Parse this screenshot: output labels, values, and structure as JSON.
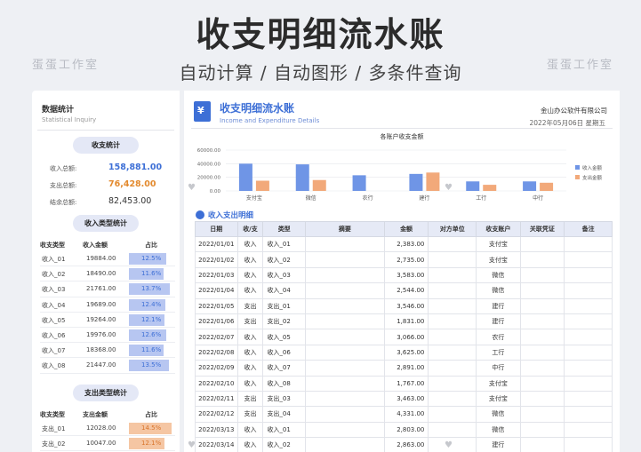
{
  "header": {
    "title": "收支明细流水账",
    "subtitle": "自动计算 / 自动图形 / 多条件查询",
    "watermark": "蛋蛋工作室"
  },
  "left": {
    "title": "数据统计",
    "subtitle": "Statistical Inquiry",
    "summary_pill": "收支统计",
    "summary": [
      {
        "label": "收入总额:",
        "value": "158,881.00",
        "color": "#3d6fd6"
      },
      {
        "label": "支出总额:",
        "value": "76,428.00",
        "color": "#e38a2e"
      },
      {
        "label": "结余总额:",
        "value": "82,453.00",
        "color": "#333333"
      }
    ],
    "income_pill": "收入类型统计",
    "income_head": [
      "收支类型",
      "收入金额",
      "占比"
    ],
    "income_rows": [
      {
        "type": "收入_01",
        "amount": "19884.00",
        "pct": "12.5%",
        "frac": 0.125
      },
      {
        "type": "收入_02",
        "amount": "18490.00",
        "pct": "11.6%",
        "frac": 0.116
      },
      {
        "type": "收入_03",
        "amount": "21761.00",
        "pct": "13.7%",
        "frac": 0.137
      },
      {
        "type": "收入_04",
        "amount": "19689.00",
        "pct": "12.4%",
        "frac": 0.124
      },
      {
        "type": "收入_05",
        "amount": "19264.00",
        "pct": "12.1%",
        "frac": 0.121
      },
      {
        "type": "收入_06",
        "amount": "19976.00",
        "pct": "12.6%",
        "frac": 0.126
      },
      {
        "type": "收入_07",
        "amount": "18368.00",
        "pct": "11.6%",
        "frac": 0.116
      },
      {
        "type": "收入_08",
        "amount": "21447.00",
        "pct": "13.5%",
        "frac": 0.135
      }
    ],
    "expense_pill": "支出类型统计",
    "expense_head": [
      "收支类型",
      "支出金额",
      "占比"
    ],
    "expense_rows": [
      {
        "type": "支出_01",
        "amount": "12028.00",
        "pct": "14.5%",
        "frac": 0.145
      },
      {
        "type": "支出_02",
        "amount": "10047.00",
        "pct": "12.1%",
        "frac": 0.121
      }
    ],
    "income_bar_color": "#b7c6f1",
    "expense_bar_color": "#f5c6a3"
  },
  "right": {
    "title": "收支明细流水账",
    "subtitle": "Income and Expenditure Details",
    "company": "金山办公软件有限公司",
    "date": "2022年05月06日   星期五",
    "icon": "wallet-icon",
    "section_title": "收入支出明细",
    "columns": [
      "日期",
      "收/支",
      "类型",
      "摘要",
      "金额",
      "对方单位",
      "收支账户",
      "关联凭证",
      "备注"
    ],
    "rows": [
      [
        "2022/01/01",
        "收入",
        "收入_01",
        "",
        "2,383.00",
        "",
        "支付宝",
        "",
        ""
      ],
      [
        "2022/01/02",
        "收入",
        "收入_02",
        "",
        "2,735.00",
        "",
        "支付宝",
        "",
        ""
      ],
      [
        "2022/01/03",
        "收入",
        "收入_03",
        "",
        "3,583.00",
        "",
        "微信",
        "",
        ""
      ],
      [
        "2022/01/04",
        "收入",
        "收入_04",
        "",
        "2,544.00",
        "",
        "微信",
        "",
        ""
      ],
      [
        "2022/01/05",
        "支出",
        "支出_01",
        "",
        "3,546.00",
        "",
        "建行",
        "",
        ""
      ],
      [
        "2022/01/06",
        "支出",
        "支出_02",
        "",
        "1,831.00",
        "",
        "建行",
        "",
        ""
      ],
      [
        "2022/02/07",
        "收入",
        "收入_05",
        "",
        "3,066.00",
        "",
        "农行",
        "",
        ""
      ],
      [
        "2022/02/08",
        "收入",
        "收入_06",
        "",
        "3,625.00",
        "",
        "工行",
        "",
        ""
      ],
      [
        "2022/02/09",
        "收入",
        "收入_07",
        "",
        "2,891.00",
        "",
        "中行",
        "",
        ""
      ],
      [
        "2022/02/10",
        "收入",
        "收入_08",
        "",
        "1,767.00",
        "",
        "支付宝",
        "",
        ""
      ],
      [
        "2022/02/11",
        "支出",
        "支出_03",
        "",
        "3,463.00",
        "",
        "支付宝",
        "",
        ""
      ],
      [
        "2022/02/12",
        "支出",
        "支出_04",
        "",
        "4,331.00",
        "",
        "微信",
        "",
        ""
      ],
      [
        "2022/03/13",
        "收入",
        "收入_01",
        "",
        "2,803.00",
        "",
        "微信",
        "",
        ""
      ],
      [
        "2022/03/14",
        "收入",
        "收入_02",
        "",
        "2,863.00",
        "",
        "建行",
        "",
        ""
      ]
    ]
  },
  "chart_data": {
    "type": "bar",
    "title": "各账户收支金额",
    "categories": [
      "支付宝",
      "微信",
      "农行",
      "建行",
      "工行",
      "中行"
    ],
    "series": [
      {
        "name": "收入金额",
        "values": [
          40000,
          39000,
          23000,
          25000,
          14000,
          14000
        ],
        "color": "#6f95e6"
      },
      {
        "name": "支出金额",
        "values": [
          15000,
          16000,
          0,
          27000,
          9000,
          12000
        ],
        "color": "#f2a97a"
      }
    ],
    "ylim": [
      0,
      60000
    ],
    "yticks": [
      "0.00",
      "20000.00",
      "40000.00",
      "60000.00"
    ],
    "legend": "right",
    "grid": true
  }
}
